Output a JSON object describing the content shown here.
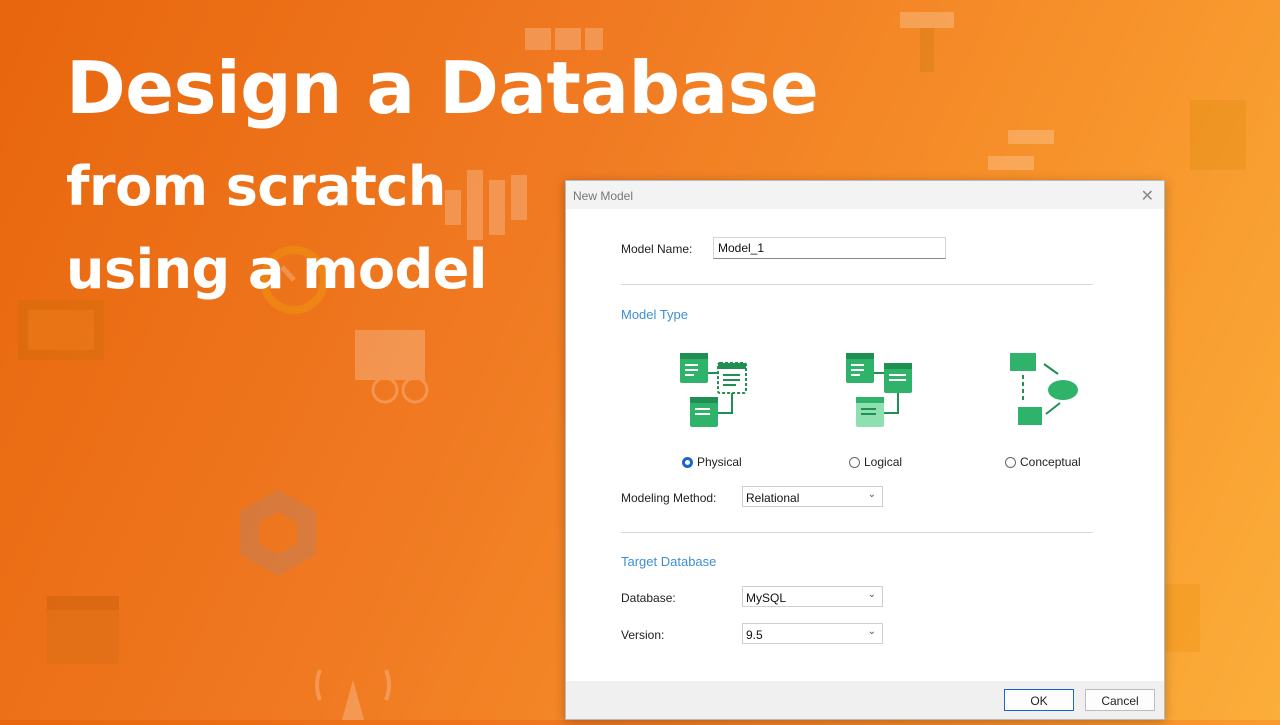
{
  "headline": {
    "line1": "Design a Database",
    "line2": "from scratch",
    "line3": "using a model"
  },
  "dialog": {
    "title": "New Model",
    "close_glyph": "✕",
    "model_name_label": "Model Name:",
    "model_name_value": "Model_1",
    "model_type_heading": "Model Type",
    "model_types": [
      {
        "label": "Physical",
        "icon": "physical-model-icon",
        "selected": true
      },
      {
        "label": "Logical",
        "icon": "logical-model-icon",
        "selected": false
      },
      {
        "label": "Conceptual",
        "icon": "conceptual-model-icon",
        "selected": false
      }
    ],
    "modeling_method_label": "Modeling Method:",
    "modeling_method_value": "Relational",
    "target_db_heading": "Target Database",
    "database_label": "Database:",
    "database_value": "MySQL",
    "version_label": "Version:",
    "version_value": "9.5",
    "ok_label": "OK",
    "cancel_label": "Cancel"
  },
  "colors": {
    "accent": "#1a66c9",
    "section_heading": "#3d8fd4",
    "icon_green": "#2fb36b",
    "icon_green_light": "#8fe0b0"
  }
}
